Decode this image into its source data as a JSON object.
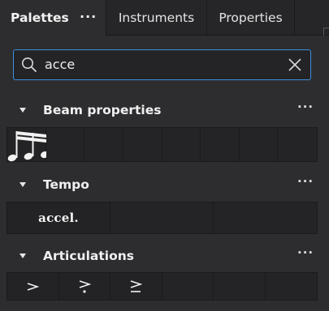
{
  "tabs": {
    "palettes": "Palettes",
    "more": "···",
    "instruments": "Instruments",
    "properties": "Properties"
  },
  "search": {
    "value": "acce",
    "placeholder": ""
  },
  "sections": [
    {
      "title": "Beam properties",
      "more": "···",
      "items": [
        "beam-16th-notes-icon"
      ]
    },
    {
      "title": "Tempo",
      "more": "···",
      "items": [
        "accel."
      ]
    },
    {
      "title": "Articulations",
      "more": "···",
      "items": [
        "accent-icon",
        "accent-staccato-icon",
        "accent-tenuto-icon"
      ]
    }
  ],
  "colors": {
    "accent": "#3d8fe0",
    "background": "#2d2d2f",
    "cell": "#242426"
  }
}
